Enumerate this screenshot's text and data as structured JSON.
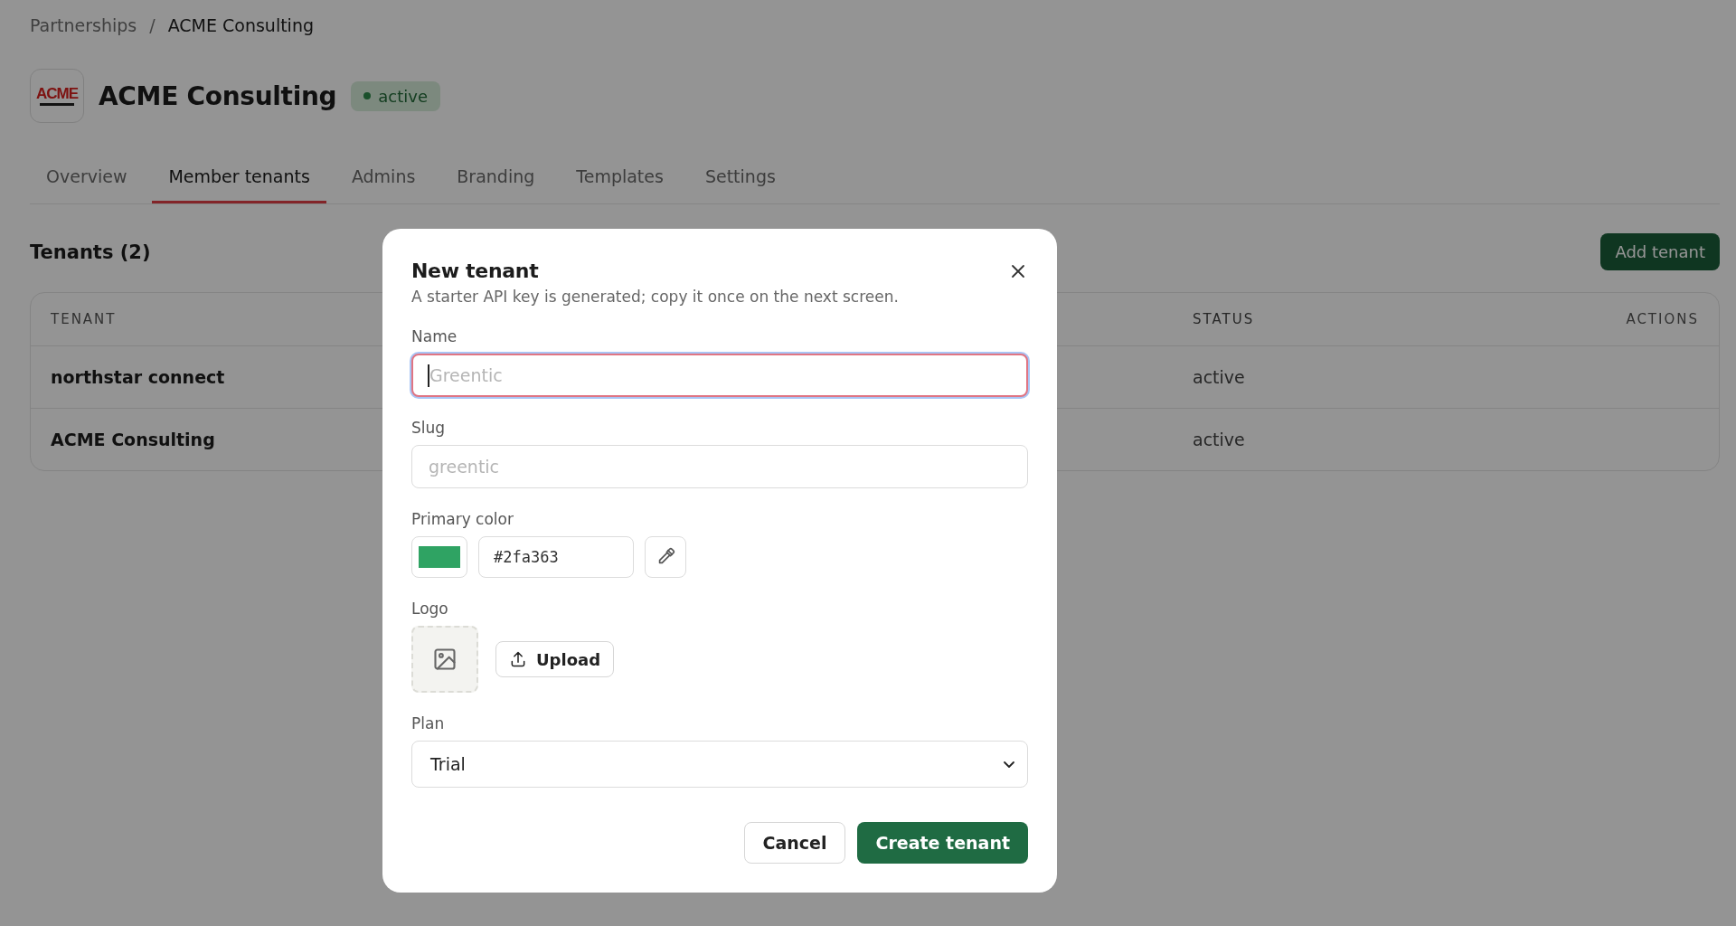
{
  "breadcrumb": {
    "separator": "/",
    "items": [
      {
        "label": "Partnerships",
        "current": false
      },
      {
        "label": "ACME Consulting",
        "current": true
      }
    ]
  },
  "org": {
    "logo": {
      "word": "ACME"
    },
    "name": "ACME Consulting",
    "status": "active"
  },
  "tabs": [
    {
      "label": "Overview",
      "selected": false
    },
    {
      "label": "Member tenants",
      "selected": true
    },
    {
      "label": "Admins",
      "selected": false
    },
    {
      "label": "Branding",
      "selected": false
    },
    {
      "label": "Templates",
      "selected": false
    },
    {
      "label": "Settings",
      "selected": false
    }
  ],
  "section": {
    "title": "Tenants (2)",
    "action": "Add tenant"
  },
  "table": {
    "columns": [
      "TENANT",
      "STATUS",
      "ACTIONS"
    ],
    "rows": [
      {
        "tenant": "northstar connect",
        "status": "active"
      },
      {
        "tenant": "ACME Consulting",
        "status": "active"
      }
    ]
  },
  "dialog": {
    "title": "New tenant",
    "subtitle": "A starter API key is generated; copy it once on the next screen.",
    "fields": [
      {
        "kind": "text",
        "label": "Name",
        "placeholder": "Greentic",
        "focused": true
      },
      {
        "kind": "text",
        "label": "Slug",
        "placeholder": "greentic",
        "focused": false
      },
      {
        "kind": "color",
        "label": "Primary color",
        "value": "#2fa363"
      },
      {
        "kind": "logo",
        "label": "Logo",
        "button": "Upload"
      },
      {
        "kind": "select",
        "label": "Plan",
        "value": "Trial"
      }
    ],
    "buttons": [
      {
        "label": "Cancel",
        "primary": false
      },
      {
        "label": "Create tenant",
        "primary": true
      }
    ]
  }
}
